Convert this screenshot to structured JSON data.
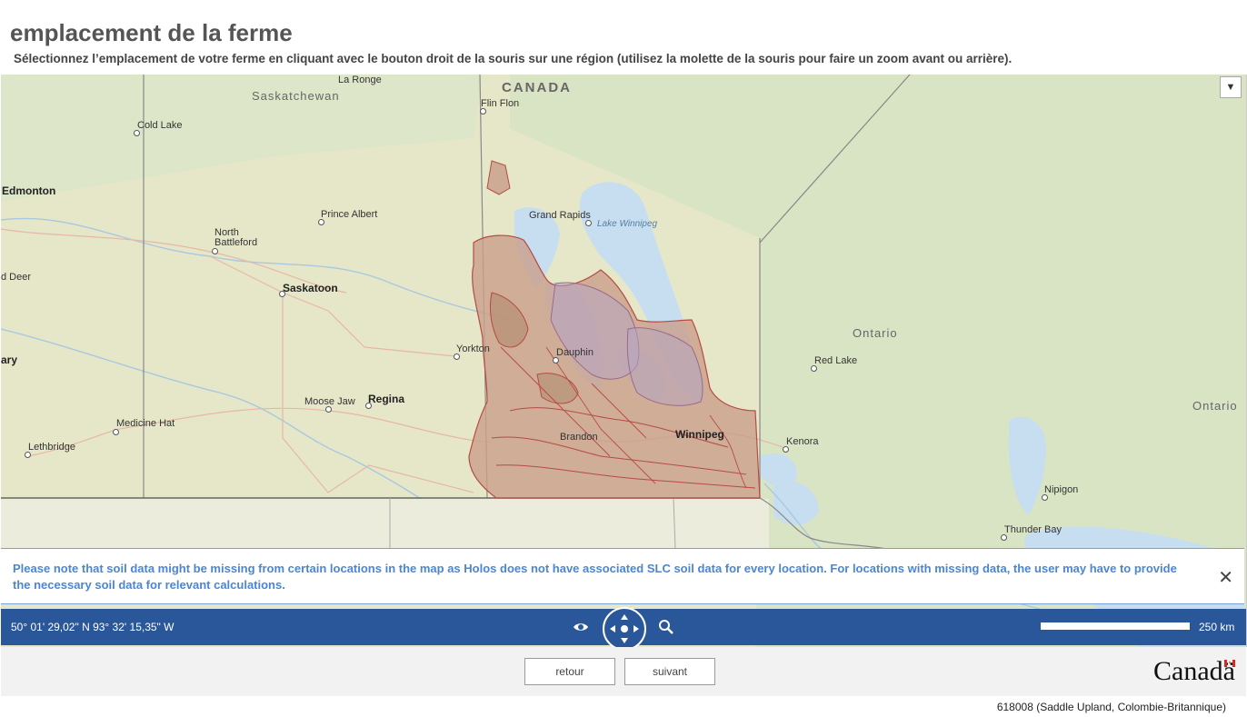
{
  "header": {
    "title": "emplacement de la ferme",
    "instructions": "Sélectionnez l’emplacement de votre ferme en cliquant avec le bouton droit de la souris sur une région (utilisez la molette de la souris pour faire un zoom avant ou arrière)."
  },
  "map": {
    "labels": {
      "la_ronge": "La Ronge",
      "saskatchewan": "Saskatchewan",
      "canada": "CANADA",
      "flin_flon": "Flin Flon",
      "cold_lake": "Cold Lake",
      "edmonton": "Edmonton",
      "prince_albert": "Prince Albert",
      "grand_rapids": "Grand Rapids",
      "lake_winnipeg": "Lake Winnipeg",
      "north_battleford_1": "North",
      "north_battleford_2": "Battleford",
      "red_deer": "d Deer",
      "saskatoon": "Saskatoon",
      "ontario_1": "Ontario",
      "ontario_2": "Ontario",
      "yorkton": "Yorkton",
      "dauphin": "Dauphin",
      "calgary": "ary",
      "red_lake": "Red Lake",
      "moose_jaw": "Moose Jaw",
      "regina": "Regina",
      "medicine_hat": "Medicine Hat",
      "winnipeg": "Winnipeg",
      "brandon": "Brandon",
      "kenora": "Kenora",
      "lethbridge": "Lethbridge",
      "nipigon": "Nipigon",
      "thunder_bay": "Thunder Bay"
    },
    "dropdown_icon": "chevron-down-icon",
    "land_color": "#e6e7c9",
    "forest_color": "#d9e4c4",
    "water_color": "#c6def0",
    "soil_polygon_fill": "#c9a08c",
    "soil_polygon_stroke": "#b84a42"
  },
  "notice": {
    "text": "Please note that soil data might be missing from certain locations in the map as Holos does not have associated SLC soil data for every location. For locations with missing data, the user may have to provide the necessary soil data for relevant calculations.",
    "close_label": "✕"
  },
  "toolbar": {
    "coordinates": "50° 01' 29,02\" N 93° 32' 15,35\" W",
    "scale_label": "250 km",
    "icons": [
      "eye-icon",
      "navigation-pan-icon",
      "zoom-icon"
    ],
    "bg_color": "#2a579a"
  },
  "footer": {
    "back_label": "retour",
    "next_label": "suivant",
    "wordmark": "Canadä"
  },
  "statusbar": {
    "text": "618008 (Saddle Upland, Colombie-Britannique)"
  }
}
